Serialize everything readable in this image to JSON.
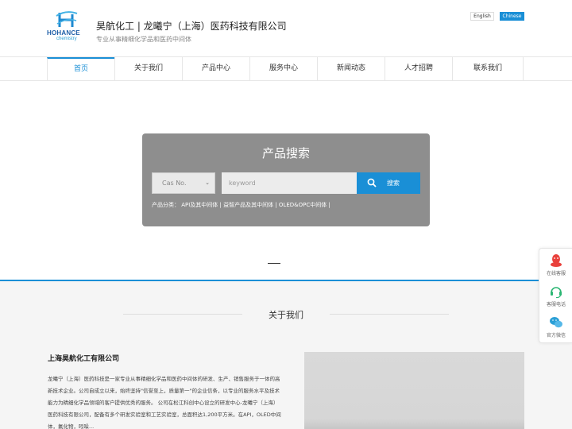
{
  "header": {
    "logo_brand": "HOHANCE",
    "logo_sub": "chemistry",
    "company_name": "昊航化工 | 龙曦宁（上海）医药科技有限公司",
    "slogan": "专业从事精细化学品和医药中间体",
    "lang_en": "English",
    "lang_zh": "Chinese"
  },
  "nav": {
    "items": [
      {
        "label": "首页"
      },
      {
        "label": "关于我们"
      },
      {
        "label": "产品中心"
      },
      {
        "label": "服务中心"
      },
      {
        "label": "新闻动态"
      },
      {
        "label": "人才招聘"
      },
      {
        "label": "联系我们"
      }
    ],
    "active_index": 0
  },
  "search": {
    "title": "产品搜索",
    "select_value": "Cas No.",
    "input_placeholder": "keyword",
    "button_label": "搜索",
    "categories": "产品分类： API及其中间体 | 益智产品及其中间体 | OLED&OPC中间体 |"
  },
  "about": {
    "title": "关于我们",
    "company": "上海昊航化工有限公司",
    "text": "龙曦宁（上海）医药科技是一家专业从事精细化学品和医药中间体的研发、生产、销售服务于一体的高新技术企业。公司自成立以来，始终坚持\"信誉至上，质量第一\"的企业信条，以专业的服务水平及技术能力为精细化学品领域的客户提供优秀的服务。 公司在松江科创中心设立的研发中心-龙曦宁（上海）医药科技有限公司，配备有多个研发实验室和工艺实验室，总面积达1,200平方米。在API，OLED中间体，氟化物，吲哚..."
  },
  "float_bar": {
    "items": [
      {
        "label": "在线客服",
        "icon": "qq-icon"
      },
      {
        "label": "客服电话",
        "icon": "headset-icon"
      },
      {
        "label": "官方微信",
        "icon": "wechat-icon"
      }
    ]
  },
  "colors": {
    "accent": "#1a8fd6",
    "panel": "#8e8e8e",
    "qq": "#e9413c",
    "phone": "#2bb673",
    "wechat": "#2a9fd6"
  }
}
